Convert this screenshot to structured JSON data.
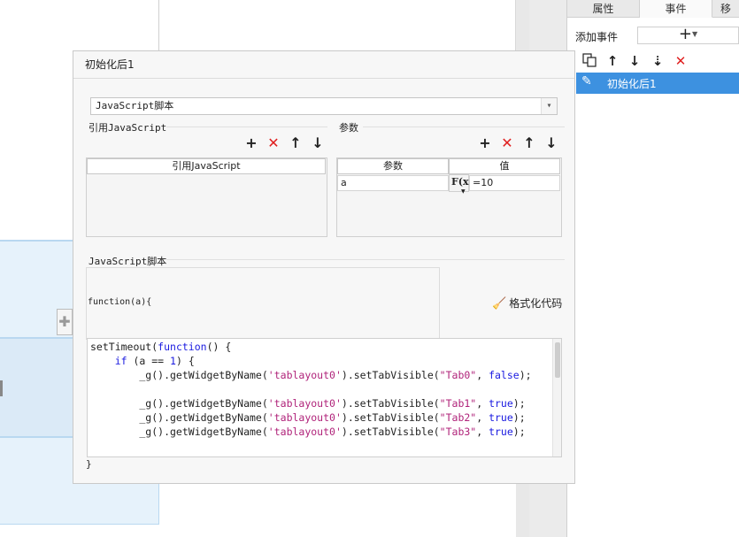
{
  "right_panel": {
    "tabs": [
      "属性",
      "事件",
      "移"
    ],
    "add_event_label": "添加事件",
    "add_event_button": "+",
    "toolbar_icons": [
      "copy-icon",
      "arrow-up-icon",
      "arrow-down-icon",
      "sort-down-icon",
      "delete-icon"
    ],
    "events": [
      {
        "label": "初始化后1",
        "icon": "pencil-icon",
        "selected": true
      }
    ],
    "selected_color": "#3d91e0"
  },
  "dialog": {
    "title": "初始化后1",
    "script_type": "JavaScript脚本",
    "ref_js": {
      "section_label": "引用JavaScript",
      "column_header": "引用JavaScript",
      "rows": []
    },
    "params": {
      "section_label": "参数",
      "column_headers": [
        "参数",
        "值"
      ],
      "rows": [
        {
          "name": "a",
          "fx": "F(x)",
          "value": "=10"
        }
      ]
    },
    "script_section_label": "JavaScript脚本",
    "function_signature": "function(a){",
    "format_button": "格式化代码",
    "code_lines": [
      "setTimeout(function() {",
      "    if (a == 1) {",
      "        _g().getWidgetByName('tablayout0').setTabVisible(\"Tab0\", false);",
      "",
      "        _g().getWidgetByName('tablayout0').setTabVisible(\"Tab1\", true);",
      "        _g().getWidgetByName('tablayout0').setTabVisible(\"Tab2\", true);",
      "        _g().getWidgetByName('tablayout0').setTabVisible(\"Tab3\", true);"
    ],
    "closing_brace": "}",
    "colors": {
      "keyword": "#1a1ae0",
      "string": "#b0237a",
      "delete": "#e02020"
    }
  }
}
